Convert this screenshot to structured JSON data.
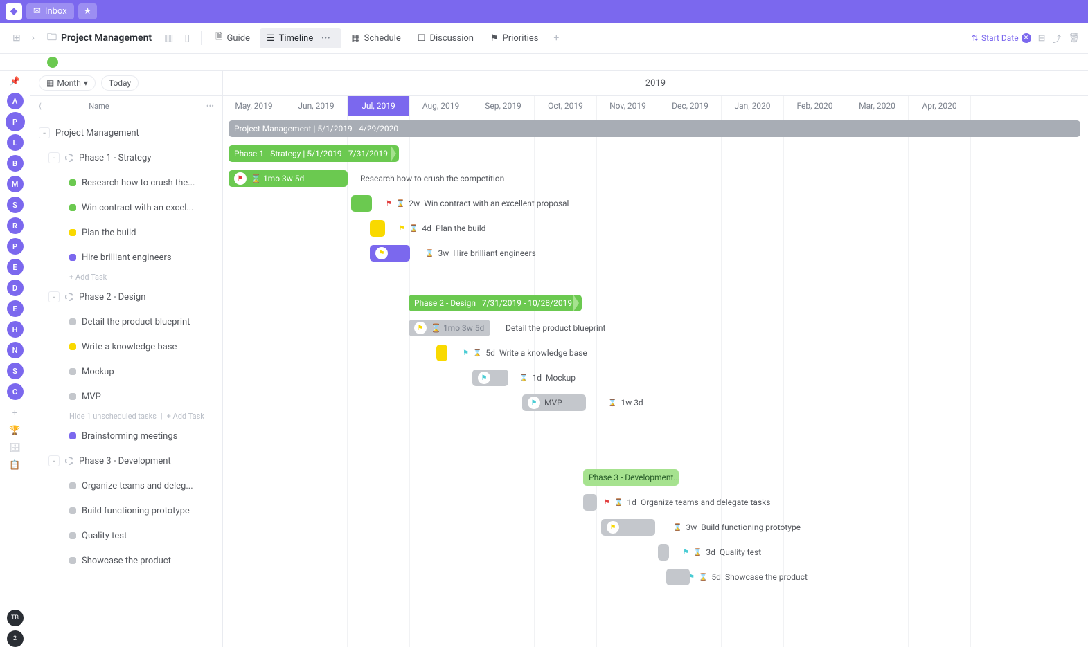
{
  "topbar": {
    "inbox": "Inbox"
  },
  "breadcrumb": {
    "title": "Project Management"
  },
  "tabs": {
    "guide": "Guide",
    "timeline": "Timeline",
    "schedule": "Schedule",
    "discussion": "Discussion",
    "priorities": "Priorities"
  },
  "toolbar_right": {
    "sort": "Start Date"
  },
  "left_rail": {
    "avatars": [
      "A",
      "P",
      "L",
      "B",
      "M",
      "S",
      "R",
      "P",
      "E",
      "D",
      "E",
      "H",
      "N",
      "S",
      "C"
    ],
    "tb": "TB",
    "count": "2"
  },
  "sidebar": {
    "month_label": "Month",
    "today": "Today",
    "name_header": "Name",
    "root": "Project Management",
    "phase1": {
      "name": "Phase 1 - Strategy",
      "tasks": [
        "Research how to crush the...",
        "Win contract with an excel...",
        "Plan the build",
        "Hire brilliant engineers"
      ],
      "add": "+ Add Task"
    },
    "phase2": {
      "name": "Phase 2 - Design",
      "tasks": [
        "Detail the product blueprint",
        "Write a knowledge base",
        "Mockup",
        "MVP"
      ],
      "hide": "Hide 1 unscheduled tasks",
      "add": "+ Add Task",
      "extra": "Brainstorming meetings"
    },
    "phase3": {
      "name": "Phase 3 - Development",
      "tasks": [
        "Organize teams and deleg...",
        "Build functioning prototype",
        "Quality test",
        "Showcase the product"
      ]
    }
  },
  "timeline": {
    "year": "2019",
    "months": [
      "May, 2019",
      "Jun, 2019",
      "Jul, 2019",
      "Aug, 2019",
      "Sep, 2019",
      "Oct, 2019",
      "Nov, 2019",
      "Dec, 2019",
      "Jan, 2020",
      "Feb, 2020",
      "Mar, 2020",
      "Apr, 2020"
    ],
    "active_month_index": 2,
    "root_bar": "Project Management | 5/1/2019 - 4/29/2020",
    "phase1_bar": "Phase 1 - Strategy | 5/1/2019 - 7/31/2019",
    "phase2_bar": "Phase 2 - Design | 7/31/2019 - 10/28/2019",
    "phase3_bar": "Phase 3 - Development...",
    "items": {
      "t1_dur": "1mo 3w 5d",
      "t1_name": "Research how to crush the competition",
      "t2_dur": "2w",
      "t2_name": "Win contract with an excellent proposal",
      "t3_dur": "4d",
      "t3_name": "Plan the build",
      "t4_dur": "3w",
      "t4_name": "Hire brilliant engineers",
      "t5_dur": "1mo 3w 5d",
      "t5_name": "Detail the product blueprint",
      "t6_dur": "5d",
      "t6_name": "Write a knowledge base",
      "t7_dur": "1d",
      "t7_name": "Mockup",
      "t8_name": "MVP",
      "t8_dur": "1w 3d",
      "t9_dur": "1d",
      "t9_name": "Organize teams and delegate tasks",
      "t10_dur": "3w",
      "t10_name": "Build functioning prototype",
      "t11_dur": "3d",
      "t11_name": "Quality test",
      "t12_dur": "5d",
      "t12_name": "Showcase the product"
    }
  },
  "colors": {
    "green": "#6bc950",
    "green_light": "#a6e28f",
    "yellow": "#f9d900",
    "purple": "#7b68ee",
    "grey": "#c4c7cc",
    "grey_dark": "#a8adb5",
    "red_flag": "#e23f3f",
    "cyan_flag": "#49ccd4"
  },
  "chart_data": {
    "type": "gantt",
    "x_axis": {
      "start": "2019-05-01",
      "end": "2020-04-30",
      "ticks": [
        "May, 2019",
        "Jun, 2019",
        "Jul, 2019",
        "Aug, 2019",
        "Sep, 2019",
        "Oct, 2019",
        "Nov, 2019",
        "Dec, 2019",
        "Jan, 2020",
        "Feb, 2020",
        "Mar, 2020",
        "Apr, 2020"
      ]
    },
    "groups": [
      {
        "name": "Project Management",
        "start": "2019-05-01",
        "end": "2020-04-29"
      },
      {
        "name": "Phase 1 - Strategy",
        "start": "2019-05-01",
        "end": "2019-07-31",
        "tasks": [
          {
            "name": "Research how to crush the competition",
            "start": "2019-05-01",
            "duration": "1mo 3w 5d",
            "color": "#6bc950",
            "flag": "red"
          },
          {
            "name": "Win contract with an excellent proposal",
            "start": "2019-07-01",
            "duration": "2w",
            "color": "#6bc950",
            "flag": "red"
          },
          {
            "name": "Plan the build",
            "start": "2019-07-12",
            "duration": "4d",
            "color": "#f9d900",
            "flag": "yellow"
          },
          {
            "name": "Hire brilliant engineers",
            "start": "2019-07-12",
            "duration": "3w",
            "color": "#7b68ee",
            "flag": "yellow"
          }
        ]
      },
      {
        "name": "Phase 2 - Design",
        "start": "2019-07-31",
        "end": "2019-10-28",
        "tasks": [
          {
            "name": "Detail the product blueprint",
            "start": "2019-07-31",
            "duration": "1mo 3w 5d",
            "color": "#c4c7cc",
            "flag": "yellow"
          },
          {
            "name": "Write a knowledge base",
            "start": "2019-08-20",
            "duration": "5d",
            "color": "#f9d900",
            "flag": "cyan"
          },
          {
            "name": "Mockup",
            "start": "2019-09-05",
            "duration": "1d",
            "color": "#c4c7cc",
            "flag": "cyan"
          },
          {
            "name": "MVP",
            "start": "2019-09-20",
            "duration": "1w 3d",
            "color": "#c4c7cc",
            "flag": "cyan"
          }
        ]
      },
      {
        "name": "Phase 3 - Development",
        "start": "2019-10-28",
        "end": "2019-12-20",
        "tasks": [
          {
            "name": "Organize teams and delegate tasks",
            "start": "2019-10-28",
            "duration": "1d",
            "color": "#c4c7cc",
            "flag": "red"
          },
          {
            "name": "Build functioning prototype",
            "start": "2019-11-01",
            "duration": "3w",
            "color": "#c4c7cc",
            "flag": "yellow"
          },
          {
            "name": "Quality test",
            "start": "2019-11-22",
            "duration": "3d",
            "color": "#c4c7cc",
            "flag": "cyan"
          },
          {
            "name": "Showcase the product",
            "start": "2019-11-28",
            "duration": "5d",
            "color": "#c4c7cc",
            "flag": "cyan"
          }
        ]
      }
    ]
  }
}
